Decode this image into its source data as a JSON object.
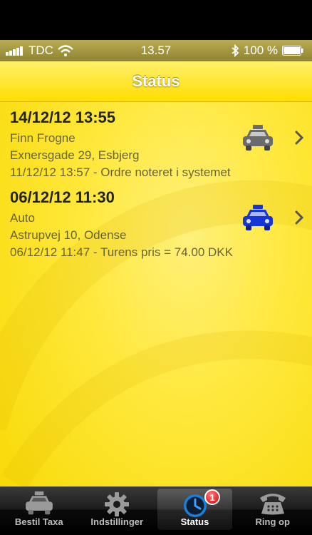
{
  "statusbar": {
    "carrier": "TDC",
    "time": "13.57",
    "battery": "100 %"
  },
  "navbar": {
    "title": "Status"
  },
  "orders": [
    {
      "datetime": "14/12/12 13:55",
      "name": "Finn Frogne",
      "address": "Exnersgade 29, Esbjerg",
      "status": "11/12/12 13:57 - Ordre noteret i systemet",
      "car_color": "#6b6b6b"
    },
    {
      "datetime": "06/12/12 11:30",
      "name": "Auto",
      "address": "Astrupvej 10, Odense",
      "status": "06/12/12 11:47 - Turens pris = 74.00 DKK",
      "car_color": "#1535d8"
    }
  ],
  "tabs": [
    {
      "label": "Bestil Taxa",
      "icon": "taxi-icon"
    },
    {
      "label": "Indstillinger",
      "icon": "gear-icon"
    },
    {
      "label": "Status",
      "icon": "clock-icon",
      "badge": "1",
      "active": true
    },
    {
      "label": "Ring op",
      "icon": "phone-icon"
    }
  ],
  "colors": {
    "accent_yellow": "#ffe83c",
    "text_secondary": "#6a6435"
  }
}
